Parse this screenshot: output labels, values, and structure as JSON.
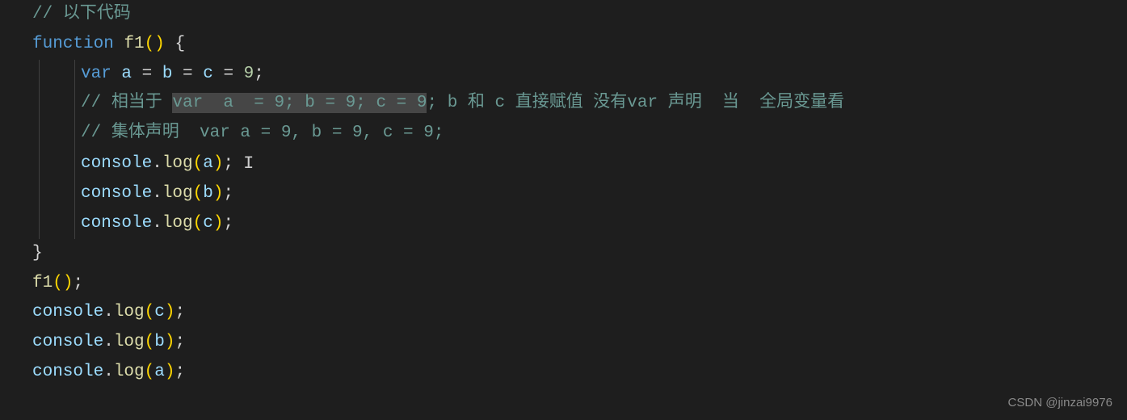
{
  "editor": {
    "lines": {
      "l1_comment_slashes": "// ",
      "l1_comment_text": "以下代码",
      "l2_kw": "function",
      "l2_fn": "f1",
      "l2_parens": "()",
      "l2_brace": " {",
      "l3_var": "var",
      "l3_a": " a ",
      "l3_eq1": "=",
      "l3_b": " b ",
      "l3_eq2": "=",
      "l3_c": " c ",
      "l3_eq3": "=",
      "l3_num": " 9",
      "l3_semi": ";",
      "l4_slashes": "// ",
      "l4_text1": "相当于 ",
      "l4_sel": "var  a  = 9; b = 9; c = 9",
      "l4_text2": "; b 和 c 直接赋值 没有var 声明  当  全局变量看",
      "l5_slashes": "// ",
      "l5_text": "集体声明  var a = 9, b = 9, c = 9;",
      "l6_console": "console",
      "l6_dot": ".",
      "l6_log": "log",
      "l6_open": "(",
      "l6_arg": "a",
      "l6_close": ")",
      "l6_semi": ";",
      "l7_console": "console",
      "l7_dot": ".",
      "l7_log": "log",
      "l7_open": "(",
      "l7_arg": "b",
      "l7_close": ")",
      "l7_semi": ";",
      "l8_console": "console",
      "l8_dot": ".",
      "l8_log": "log",
      "l8_open": "(",
      "l8_arg": "c",
      "l8_close": ")",
      "l8_semi": ";",
      "l9_brace": "}",
      "l10_fn": "f1",
      "l10_parens_open": "(",
      "l10_parens_close": ")",
      "l10_semi": ";",
      "l11_console": "console",
      "l11_dot": ".",
      "l11_log": "log",
      "l11_open": "(",
      "l11_arg": "c",
      "l11_close": ")",
      "l11_semi": ";",
      "l12_console": "console",
      "l12_dot": ".",
      "l12_log": "log",
      "l12_open": "(",
      "l12_arg": "b",
      "l12_close": ")",
      "l12_semi": ";",
      "l13_console": "console",
      "l13_dot": ".",
      "l13_log": "log",
      "l13_open": "(",
      "l13_arg": "a",
      "l13_close": ")",
      "l13_semi": ";"
    }
  },
  "watermark": "CSDN @jinzai9976",
  "ibeam": "I"
}
